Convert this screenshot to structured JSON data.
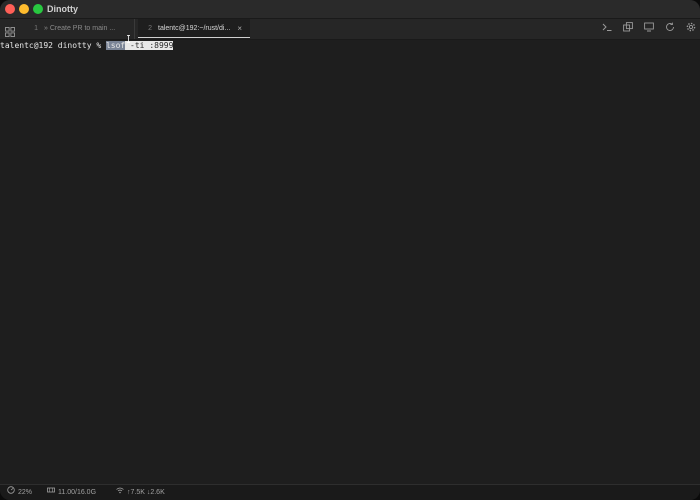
{
  "window": {
    "title": "Dinotty"
  },
  "tabs": [
    {
      "number": "1",
      "label": "» Create PR to main ...",
      "active": false
    },
    {
      "number": "2",
      "label": "talentc@192:~/rust/di...",
      "active": true,
      "close": "×"
    }
  ],
  "toolbar": {
    "icons": [
      "terminal-prompt-icon",
      "copy-icon",
      "display-icon",
      "refresh-icon",
      "gear-icon"
    ]
  },
  "terminal": {
    "prompt": "talentc@192 dinotty % ",
    "command": "lsof",
    "args": " -ti :8999"
  },
  "status": {
    "cpu": "22%",
    "memory": "11.00/16.0G",
    "network": "↑7.5K ↓2.6K"
  }
}
